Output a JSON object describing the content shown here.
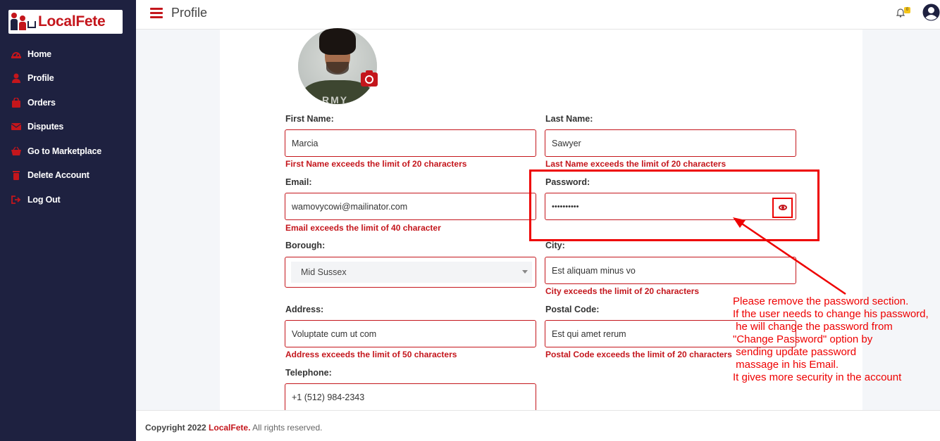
{
  "brand": {
    "logo_text": "LocalFete"
  },
  "sidebar": {
    "items": [
      {
        "label": "Home",
        "icon": "dashboard-icon"
      },
      {
        "label": "Profile",
        "icon": "user-icon"
      },
      {
        "label": "Orders",
        "icon": "shopping-bag-icon"
      },
      {
        "label": "Disputes",
        "icon": "envelope-icon"
      },
      {
        "label": "Go to Marketplace",
        "icon": "basket-icon"
      },
      {
        "label": "Delete Account",
        "icon": "trash-icon"
      },
      {
        "label": "Log Out",
        "icon": "logout-icon"
      }
    ]
  },
  "header": {
    "title": "Profile",
    "notification_count": "0"
  },
  "form": {
    "first_name": {
      "label": "First Name:",
      "value": "Marcia",
      "error": "First Name exceeds the limit of 20 characters"
    },
    "last_name": {
      "label": "Last Name:",
      "value": "Sawyer",
      "error": "Last Name exceeds the limit of 20 characters"
    },
    "email": {
      "label": "Email:",
      "value": "wamovycowi@mailinator.com",
      "error": "Email exceeds the limit of 40 character"
    },
    "password": {
      "label": "Password:",
      "value": "••••••••••"
    },
    "borough": {
      "label": "Borough:",
      "value": "Mid Sussex"
    },
    "city": {
      "label": "City:",
      "value": "Est aliquam minus vo",
      "error": "City exceeds the limit of 20 characters"
    },
    "address": {
      "label": "Address:",
      "value": "Voluptate cum ut com",
      "error": "Address exceeds the limit of 50 characters"
    },
    "postal_code": {
      "label": "Postal Code:",
      "value": "Est qui amet rerum",
      "error": "Postal Code exceeds the limit of 20 characters"
    },
    "telephone": {
      "label": "Telephone:",
      "value": "+1 (512) 984-2343"
    }
  },
  "annotation": {
    "text": "Please remove the password section.\nIf the user needs to change his password,\n he will change the password from\n\"Change Password\" option by\n sending update password\n massage in his Email.\nIt gives more security in the account"
  },
  "footer": {
    "copyright": "Copyright 2022",
    "brand": "LocalFete.",
    "rights": "All rights reserved."
  },
  "colors": {
    "accent": "#c4161c",
    "sidebar_bg": "#1e2140",
    "annotation": "#e00000"
  }
}
